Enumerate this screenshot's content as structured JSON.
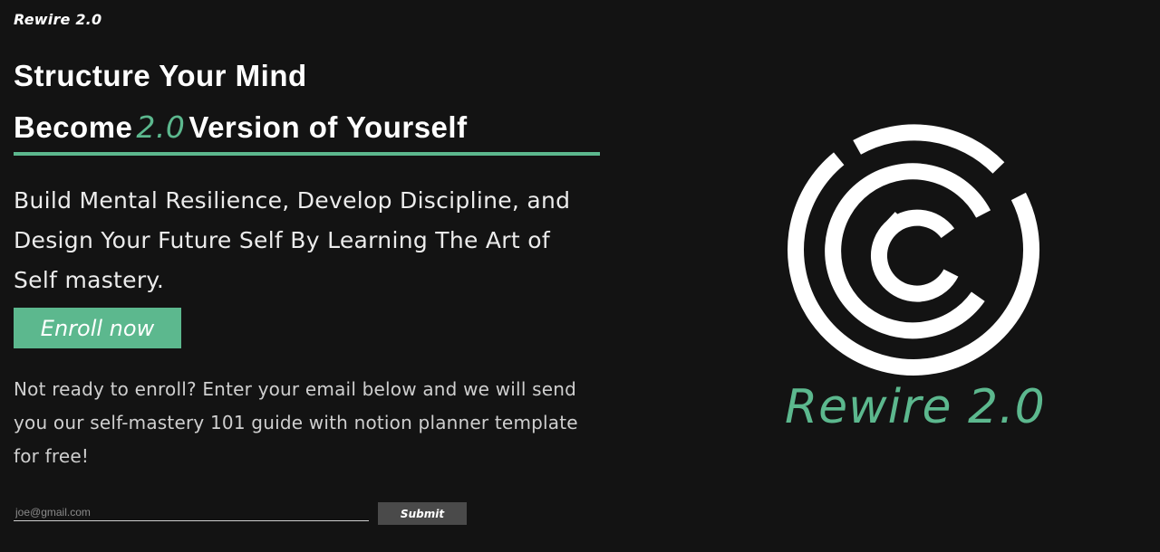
{
  "brand": {
    "name": "Rewire 2.0"
  },
  "hero": {
    "line1": "Structure Your Mind",
    "line2_prefix": "Become",
    "line2_accent": "2.0",
    "line2_suffix": "Version of Yourself",
    "accent_color": "#5cb88e"
  },
  "subtitle": "Build Mental Resilience, Develop Discipline, and Design Your Future Self By Learning The Art of Self mastery.",
  "cta": {
    "enroll_label": "Enroll now"
  },
  "newsletter": {
    "note": "Not ready to enroll? Enter your email below and we will send you our self-mastery 101 guide with notion planner template for free!",
    "email_placeholder": "joe@gmail.com",
    "submit_label": "Submit"
  },
  "logo": {
    "icon": "concentric-maze-circles-icon",
    "wordmark": "Rewire 2.0"
  },
  "colors": {
    "background": "#131313",
    "accent": "#5cb88e",
    "text": "#ffffff",
    "submit_bg": "#4a4a4a"
  }
}
